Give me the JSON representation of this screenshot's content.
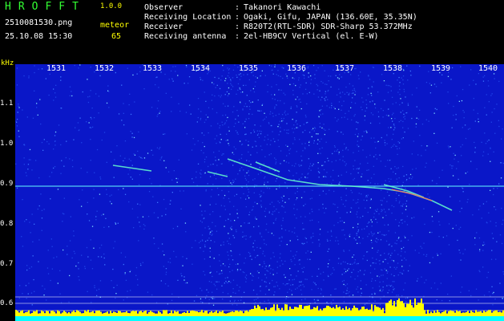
{
  "header": {
    "title": "HROFFT",
    "version": "1.0.0",
    "filename": "2510081530.png",
    "meteor_label": "meteor",
    "datetime": "25.10.08 15:30",
    "meteor_count": "65"
  },
  "info": [
    {
      "label": "Observer",
      "value": "Takanori Kawachi"
    },
    {
      "label": "Receiving Location",
      "value": "Ogaki, Gifu, JAPAN (136.60E, 35.35N)"
    },
    {
      "label": "Receiver",
      "value": "R820T2(RTL-SDR) SDR-Sharp 53.372MHz"
    },
    {
      "label": "Receiving antenna",
      "value": "2el-HB9CV Vertical (el. E-W)"
    }
  ],
  "separator": ":",
  "axis": {
    "unit": "kHz",
    "x_ticks": [
      "1531",
      "1532",
      "1533",
      "1534",
      "1535",
      "1536",
      "1537",
      "1538",
      "1539",
      "1540"
    ],
    "y_ticks": [
      "1.1",
      "1.0",
      "0.9",
      "0.8",
      "0.7",
      "0.6"
    ]
  },
  "colors": {
    "background": "#000000",
    "plot_background": "#0a17c8",
    "title": "#33ff33",
    "accent": "#ffff00",
    "trace": "#66ffff"
  }
}
